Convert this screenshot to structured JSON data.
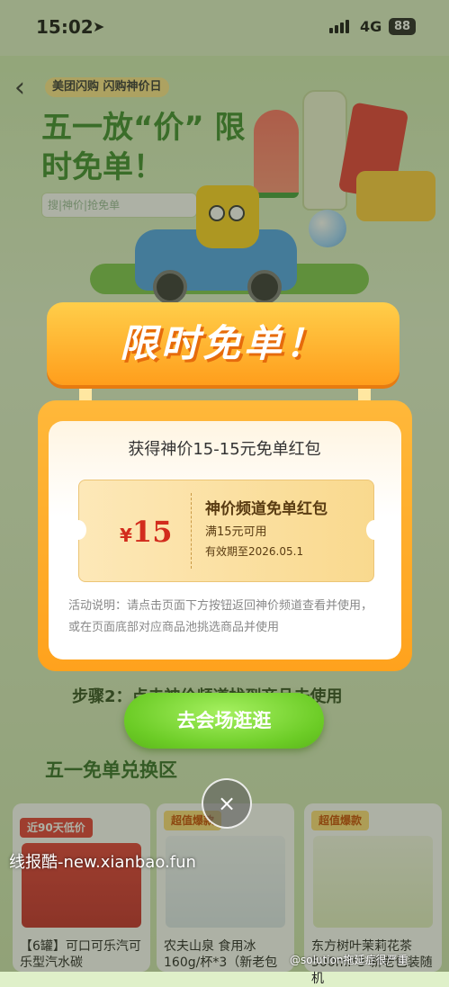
{
  "status": {
    "time": "15:02",
    "network": "4G",
    "battery": "88"
  },
  "header": {
    "back_icon": "chevron-left-icon",
    "brand": "美团闪购 闪购神价日",
    "hero_title": "五一放“价” 限时免单！",
    "search_placeholder": "搜|神价|抢免单"
  },
  "background": {
    "step2_text": "步骤2：点击神价频道找到商品去使用",
    "section_title": "五一免单兑换区",
    "cards": [
      {
        "tag": "近90天低价",
        "name": "【6罐】可口可乐汽可乐型汽水碳"
      },
      {
        "tag": "超值爆款",
        "name": "农夫山泉 食用冰 160g/杯*3（新老包"
      },
      {
        "tag": "超值爆款",
        "name": "东方树叶茉莉花茶500ml*3 新老包装随机"
      }
    ]
  },
  "popup": {
    "banner_title": "限时免单！",
    "get_text": "获得神价15-15元免单红包",
    "coupon": {
      "currency": "¥",
      "amount": "15",
      "title": "神价频道免单红包",
      "condition": "满15元可用",
      "validity": "有效期至2026.05.1"
    },
    "description": "活动说明：请点击页面下方按钮返回神价频道查看并使用，或在页面底部对应商品池挑选商品并使用",
    "cta_label": "去会场逛逛",
    "close_icon": "×"
  },
  "overlay": {
    "watermark": "线报酷-new.xianbao.fun",
    "weibo": "@solution拖延症很严重"
  },
  "colors": {
    "primary_orange": "#ffa21d",
    "cta_green": "#6ccc26",
    "price_red": "#d22c1d"
  }
}
